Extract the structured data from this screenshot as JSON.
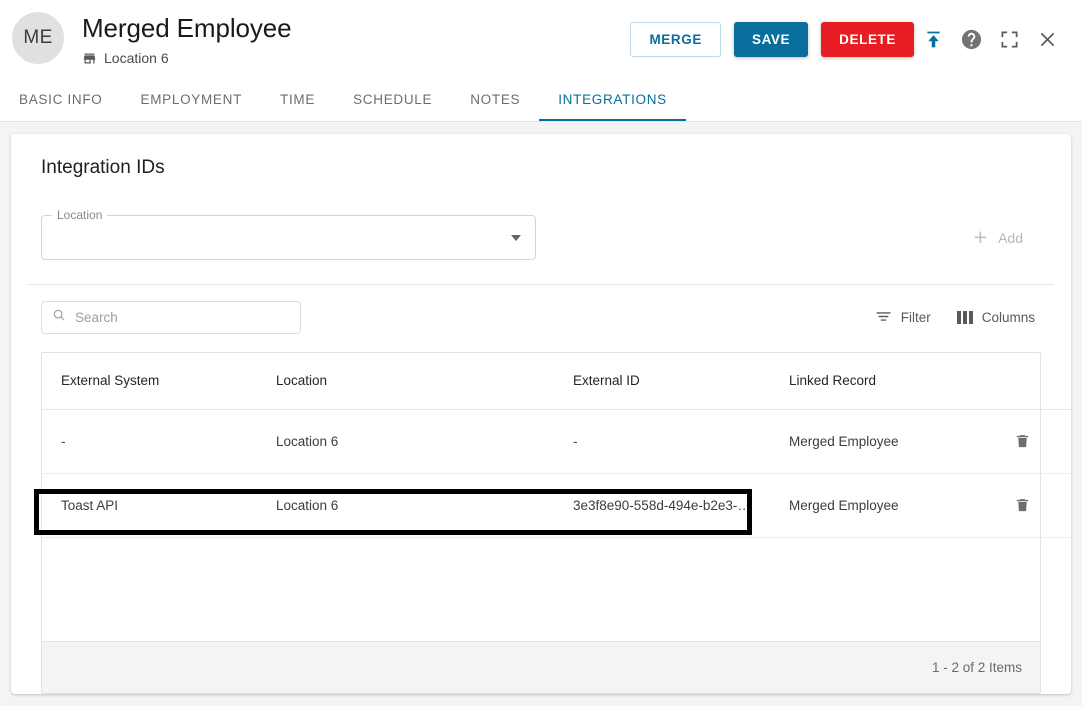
{
  "header": {
    "avatar_initials": "ME",
    "title": "Merged Employee",
    "location_icon": "store-icon",
    "location": "Location 6",
    "actions": {
      "merge_label": "MERGE",
      "save_label": "SAVE",
      "delete_label": "DELETE",
      "publish_icon": "upload-icon",
      "help_icon": "help-circle-icon",
      "fullscreen_icon": "fullscreen-icon",
      "close_icon": "close-icon"
    },
    "colors": {
      "primary": "#0a6e9c",
      "danger": "#e81c23",
      "avatar_bg": "#e0e0e0"
    }
  },
  "tabs": [
    {
      "label": "BASIC INFO",
      "active": false
    },
    {
      "label": "EMPLOYMENT",
      "active": false
    },
    {
      "label": "TIME",
      "active": false
    },
    {
      "label": "SCHEDULE",
      "active": false
    },
    {
      "label": "NOTES",
      "active": false
    },
    {
      "label": "INTEGRATIONS",
      "active": true
    }
  ],
  "card": {
    "title": "Integration IDs",
    "location_select": {
      "legend": "Location",
      "value": "",
      "caret_icon": "chevron-down-icon"
    },
    "add_button": {
      "label": "Add",
      "icon": "plus-icon",
      "disabled": true
    },
    "search": {
      "placeholder": "Search",
      "value": "",
      "icon": "search-icon"
    },
    "filter_button": {
      "label": "Filter",
      "icon": "filter-icon"
    },
    "columns_button": {
      "label": "Columns",
      "icon": "columns-icon"
    },
    "table": {
      "columns": [
        "External System",
        "Location",
        "External ID",
        "Linked Record"
      ],
      "rows": [
        {
          "external_system": "-",
          "location": "Location 6",
          "external_id": "-",
          "linked_record": "Merged Employee",
          "delete_icon": "trash-icon",
          "highlighted": false
        },
        {
          "external_system": "Toast API",
          "location": "Location 6",
          "external_id": "3e3f8e90-558d-494e-b2e3-…",
          "linked_record": "Merged Employee",
          "delete_icon": "trash-icon",
          "highlighted": true
        }
      ],
      "footer_text": "1 - 2 of 2 Items"
    }
  }
}
